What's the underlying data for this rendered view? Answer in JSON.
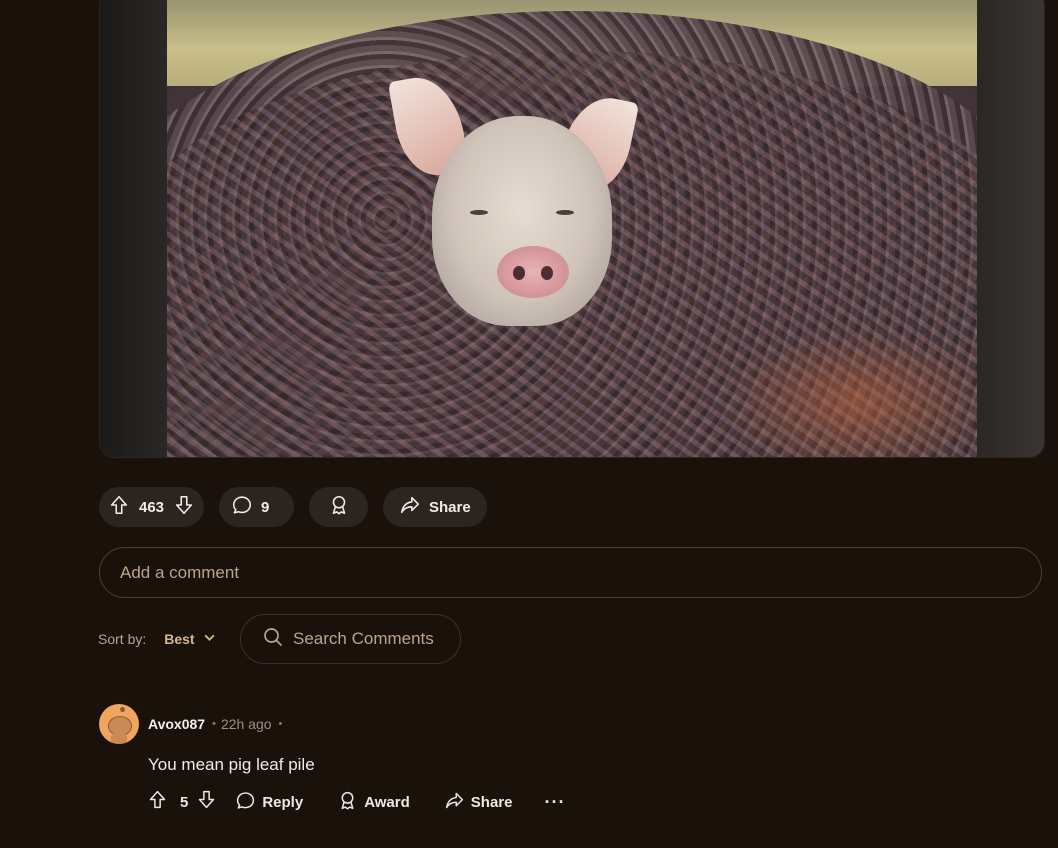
{
  "post": {
    "vote_count": "463",
    "comment_count": "9",
    "share_label": "Share"
  },
  "comment_box": {
    "placeholder": "Add a comment"
  },
  "sort": {
    "label": "Sort by:",
    "value": "Best"
  },
  "search": {
    "placeholder": "Search Comments"
  },
  "comments": [
    {
      "username": "Avox087",
      "time_ago": "22h ago",
      "body": "You mean pig leaf pile",
      "score": "5",
      "reply_label": "Reply",
      "award_label": "Award",
      "share_label": "Share",
      "more_label": "···"
    }
  ],
  "colors": {
    "background": "#1a110b",
    "pill": "#2c241e",
    "muted_text": "#b9a58f",
    "sort_accent": "#d6b591",
    "avatar": "#f0a45e"
  }
}
